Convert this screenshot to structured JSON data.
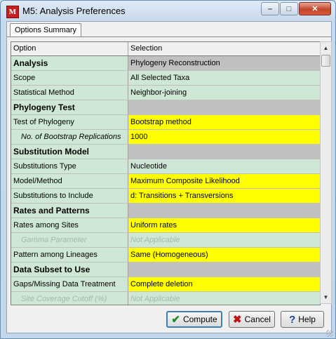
{
  "window": {
    "title": "M5: Analysis Preferences",
    "icon": "mega-logo-icon",
    "minimize_glyph": "–",
    "maximize_glyph": "□",
    "close_glyph": "✕"
  },
  "tabs": [
    {
      "label": "Options Summary"
    }
  ],
  "grid": {
    "columns": [
      "Option",
      "Selection"
    ],
    "rows": [
      {
        "option": "Analysis",
        "selection": "Phylogeny Reconstruction",
        "kind": "section-first"
      },
      {
        "option": "Scope",
        "selection": "All Selected Taxa",
        "kind": "fixed"
      },
      {
        "option": "Statistical Method",
        "selection": "Neighbor-joining",
        "kind": "fixed"
      },
      {
        "option": "Phylogeny Test",
        "selection": "",
        "kind": "section"
      },
      {
        "option": "Test of Phylogeny",
        "selection": "Bootstrap method",
        "kind": "opt"
      },
      {
        "option": "No. of Bootstrap Replications",
        "selection": "1000",
        "kind": "sub-opt"
      },
      {
        "option": "Substitution Model",
        "selection": "",
        "kind": "section"
      },
      {
        "option": "Substitutions Type",
        "selection": "Nucleotide",
        "kind": "fixed"
      },
      {
        "option": "Model/Method",
        "selection": "Maximum Composite Likelihood",
        "kind": "opt"
      },
      {
        "option": "Substitutions to Include",
        "selection": "d: Transitions + Transversions",
        "kind": "opt"
      },
      {
        "option": "Rates and Patterns",
        "selection": "",
        "kind": "section"
      },
      {
        "option": "Rates among Sites",
        "selection": "Uniform rates",
        "kind": "opt"
      },
      {
        "option": "Gamma Parameter",
        "selection": "Not Applicable",
        "kind": "disabled"
      },
      {
        "option": "Pattern among Lineages",
        "selection": "Same (Homogeneous)",
        "kind": "opt"
      },
      {
        "option": "Data Subset to Use",
        "selection": "",
        "kind": "section"
      },
      {
        "option": "Gaps/Missing Data Treatment",
        "selection": "Complete deletion",
        "kind": "opt"
      },
      {
        "option": "Site Coverage Cutoff (%)",
        "selection": "Not Applicable",
        "kind": "disabled"
      }
    ]
  },
  "buttons": {
    "compute": {
      "label": "Compute",
      "icon": "checkmark-icon"
    },
    "cancel": {
      "label": "Cancel",
      "icon": "x-icon"
    },
    "help": {
      "label": "Help",
      "icon": "question-icon"
    }
  },
  "colors": {
    "fixed_row": "#cfe8d5",
    "option_row": "#ffff00",
    "section_row": "#c0c0c0"
  }
}
